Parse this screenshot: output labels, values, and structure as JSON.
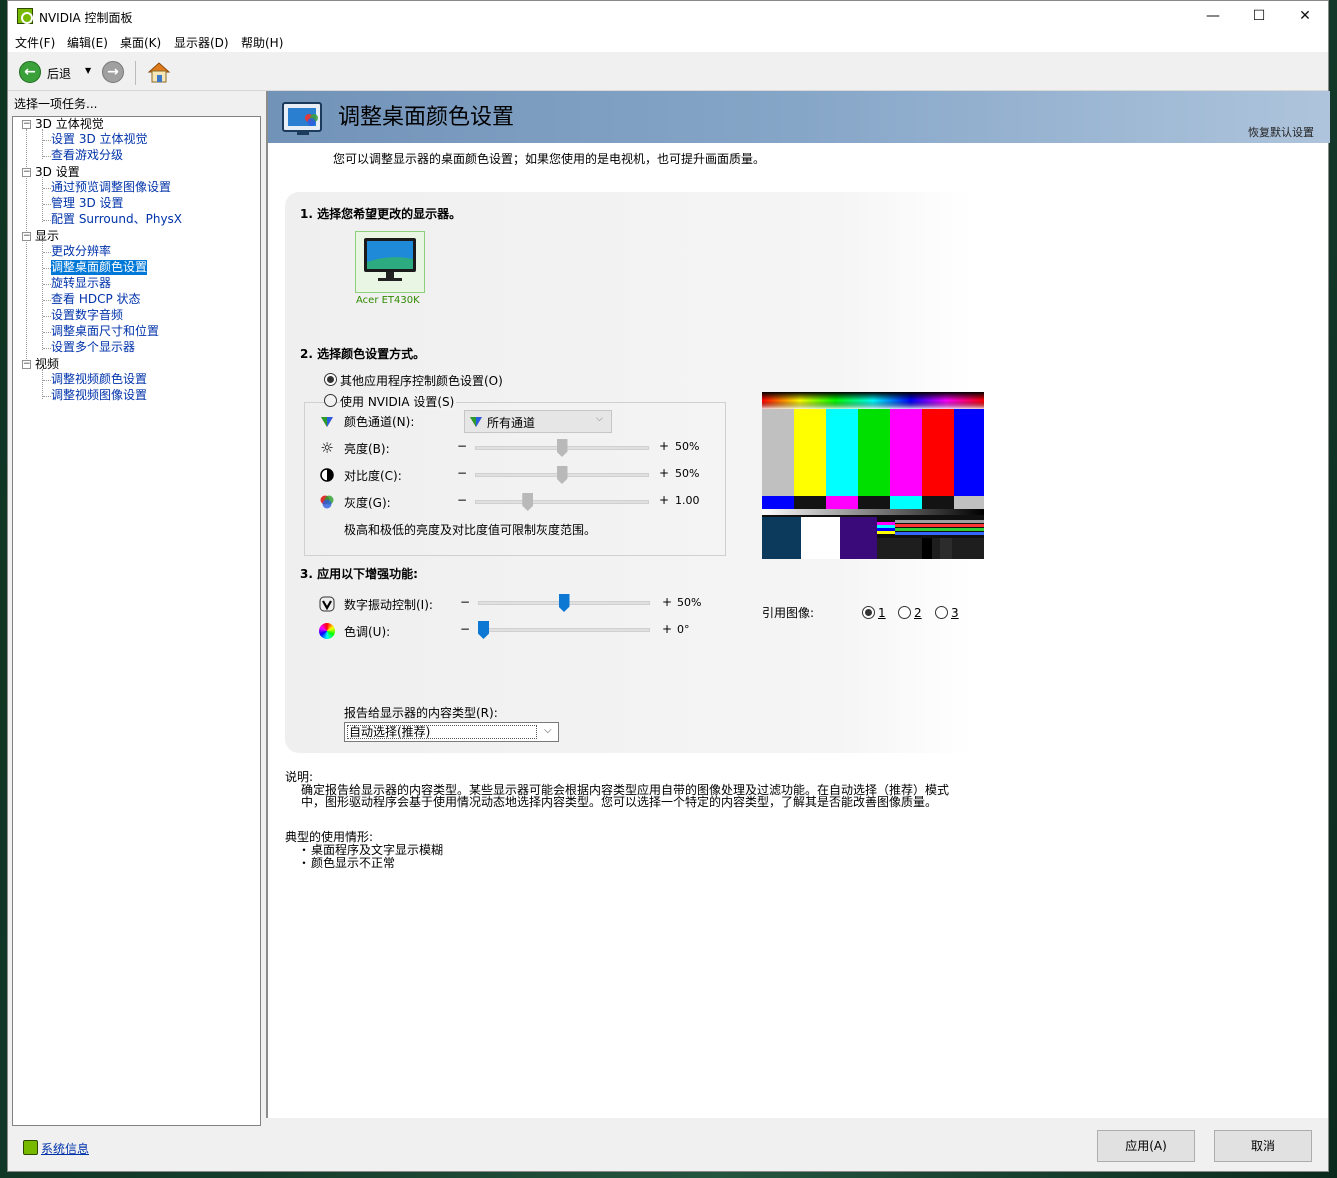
{
  "window": {
    "title": "NVIDIA 控制面板",
    "minimize_glyph": "—",
    "maximize_glyph": "☐",
    "close_glyph": "✕"
  },
  "menubar": [
    "文件(F)",
    "编辑(E)",
    "桌面(K)",
    "显示器(D)",
    "帮助(H)"
  ],
  "toolbar": {
    "back_label": "后退",
    "back_icon": "back-arrow-icon",
    "forward_icon": "forward-arrow-icon",
    "home_icon": "home-icon",
    "dropdown_glyph": "▼",
    "back_glyph": "←",
    "forward_glyph": "→"
  },
  "sidebar": {
    "title": "选择一项任务...",
    "tree": [
      {
        "label": "3D 立体视觉",
        "children": [
          "设置 3D 立体视觉",
          "查看游戏分级"
        ]
      },
      {
        "label": "3D 设置",
        "children": [
          "通过预览调整图像设置",
          "管理 3D 设置",
          "配置 Surround、PhysX"
        ]
      },
      {
        "label": "显示",
        "children": [
          "更改分辨率",
          "调整桌面颜色设置",
          "旋转显示器",
          "查看 HDCP 状态",
          "设置数字音频",
          "调整桌面尺寸和位置",
          "设置多个显示器"
        ]
      },
      {
        "label": "视频",
        "children": [
          "调整视频颜色设置",
          "调整视频图像设置"
        ]
      }
    ],
    "selected": "调整桌面颜色设置",
    "collapse_glyph": "−",
    "system_info": "系统信息"
  },
  "header": {
    "title": "调整桌面颜色设置",
    "restore_defaults": "恢复默认设置"
  },
  "intro": "您可以调整显示器的桌面颜色设置；如果您使用的是电视机，也可提升画面质量。",
  "section1": {
    "heading": "1. 选择您希望更改的显示器。",
    "monitor_name": "Acer ET430K"
  },
  "section2": {
    "heading": "2. 选择颜色设置方式。",
    "option_other": "其他应用程序控制颜色设置(O)",
    "option_nvidia": "使用 NVIDIA 设置(S)",
    "selected_option": "其他应用程序控制颜色设置(O)",
    "channel_label": "颜色通道(N):",
    "channel_value": "所有通道",
    "brightness": {
      "label": "亮度(B):",
      "minus": "−",
      "plus": "+",
      "value_text": "50%",
      "level": 0.5
    },
    "contrast": {
      "label": "对比度(C):",
      "minus": "−",
      "plus": "+",
      "value_text": "50%",
      "level": 0.5
    },
    "gamma": {
      "label": "灰度(G):",
      "minus": "−",
      "plus": "+",
      "value_text": "1.00",
      "level": 0.29
    },
    "note": "极高和极低的亮度及对比度值可限制灰度范围。"
  },
  "section3": {
    "heading": "3. 应用以下增强功能:",
    "vibrance": {
      "label": "数字振动控制(I):",
      "minus": "−",
      "plus": "+",
      "value_text": "50%",
      "level": 0.5
    },
    "hue": {
      "label": "色调(U):",
      "minus": "−",
      "plus": "+",
      "value_text": "0°",
      "level": 0.0
    }
  },
  "reference": {
    "label": "引用图像:",
    "options": [
      "1",
      "2",
      "3"
    ],
    "selected": "1"
  },
  "content_type": {
    "label": "报告给显示器的内容类型(R):",
    "value": "自动选择(推荐)"
  },
  "description": {
    "title": "说明:",
    "line1": "确定报告给显示器的内容类型。某些显示器可能会根据内容类型应用自带的图像处理及过滤功能。在自动选择（推荐）模式",
    "line2": "中，图形驱动程序会基于使用情况动态地选择内容类型。您可以选择一个特定的内容类型，了解其是否能改善图像质量。"
  },
  "usage": {
    "title": "典型的使用情形:",
    "items": [
      "桌面程序及文字显示模糊",
      "颜色显示不正常"
    ],
    "bullet": "・"
  },
  "buttons": {
    "apply": "应用(A)",
    "cancel": "取消"
  },
  "colors": {
    "accent": "#0078d7",
    "header_start": "#7293b8",
    "header_end": "#aec4dc",
    "link": "#0033aa",
    "nvidia_green": "#76b900"
  }
}
